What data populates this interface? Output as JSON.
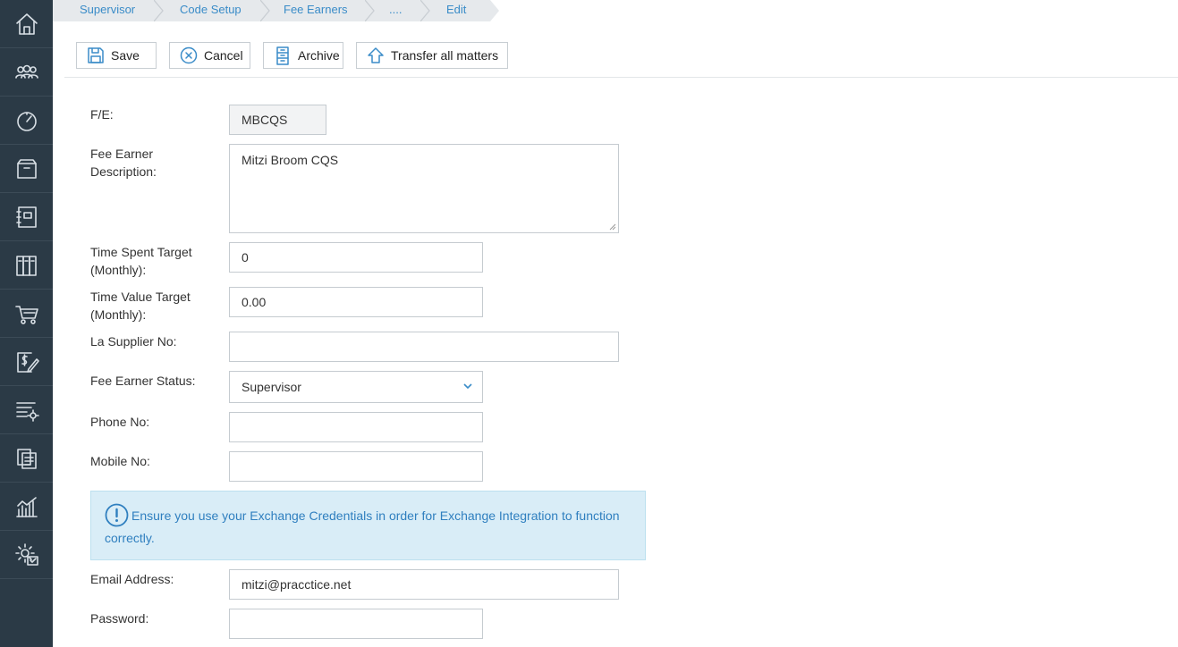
{
  "sidebar": {
    "items": [
      {
        "icon": "home-icon"
      },
      {
        "icon": "people-icon"
      },
      {
        "icon": "dashboard-icon"
      },
      {
        "icon": "archive-box-icon"
      },
      {
        "icon": "notebook-icon"
      },
      {
        "icon": "library-icon"
      },
      {
        "icon": "cart-icon"
      },
      {
        "icon": "billing-icon"
      },
      {
        "icon": "list-settings-icon"
      },
      {
        "icon": "documents-icon"
      },
      {
        "icon": "reports-chart-icon"
      },
      {
        "icon": "settings-gear-icon"
      }
    ]
  },
  "breadcrumb": {
    "items": [
      "Supervisor",
      "Code Setup",
      "Fee Earners",
      "....",
      "Edit"
    ]
  },
  "toolbar": {
    "save_label": "Save",
    "cancel_label": "Cancel",
    "archive_label": "Archive",
    "transfer_label": "Transfer all matters"
  },
  "form": {
    "fe_label": "F/E:",
    "fe_value": "MBCQS",
    "description_label_line1": "Fee Earner",
    "description_label_line2": "Description:",
    "description_value": "Mitzi Broom CQS",
    "time_spent_label_line1": "Time Spent Target",
    "time_spent_label_line2": "(Monthly):",
    "time_spent_value": "0",
    "time_value_label_line1": "Time Value Target",
    "time_value_label_line2": "(Monthly):",
    "time_value_value": "0.00",
    "la_supplier_label": "La Supplier No:",
    "la_supplier_value": "",
    "status_label": "Fee Earner Status:",
    "status_value": "Supervisor",
    "phone_label": "Phone No:",
    "phone_value": "",
    "mobile_label": "Mobile No:",
    "mobile_value": "",
    "notice_text": "Ensure you use your Exchange Credentials in order for Exchange Integration to function correctly.",
    "email_label": "Email Address:",
    "email_value": "mitzi@pracctice.net",
    "password_label": "Password:",
    "password_value": ""
  },
  "colors": {
    "sidebar_bg": "#2b3a46",
    "accent": "#3a8cc8",
    "notice_bg": "#d9edf7"
  }
}
